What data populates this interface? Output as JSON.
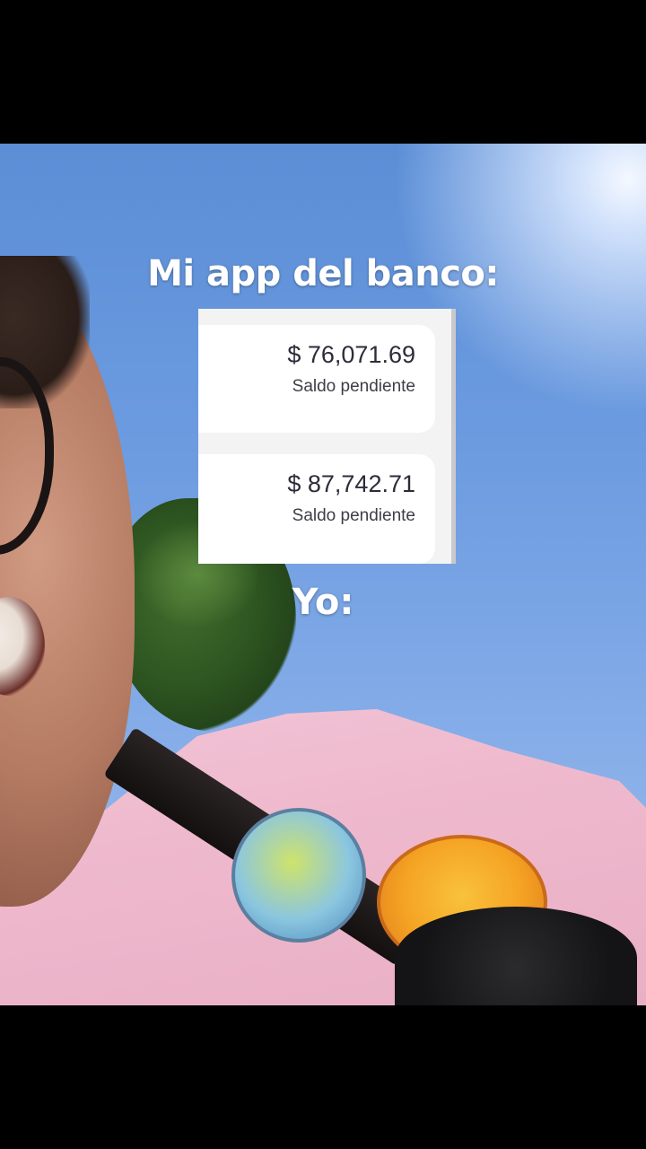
{
  "captions": {
    "top": "Mi app del banco:",
    "bottom": "Yo:"
  },
  "balances": [
    {
      "amount": "$ 76,071.69",
      "label": "Saldo pendiente"
    },
    {
      "amount": "$ 87,742.71",
      "label": "Saldo pendiente"
    }
  ],
  "colors": {
    "sky": "#6c9be0",
    "shirt": "#efb9cd",
    "caption_text": "#ffffff",
    "card_bg": "#ffffff"
  }
}
